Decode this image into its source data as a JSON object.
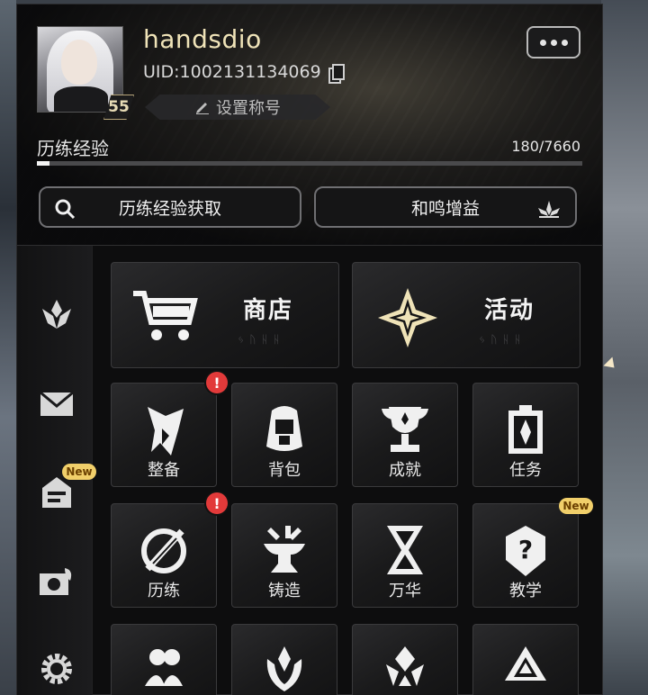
{
  "profile": {
    "username": "handsdio",
    "uid_text": "UID:1002131134069",
    "level": "55",
    "title_button": "设置称号"
  },
  "experience": {
    "label": "历练经验",
    "value_text": "180/7660",
    "current": 180,
    "max": 7660
  },
  "actions": {
    "xp_source_button": "历练经验获取",
    "resonance_button": "和鸣增益"
  },
  "sidebar": {
    "items": [
      {
        "icon": "emblem-icon"
      },
      {
        "icon": "mail-icon"
      },
      {
        "icon": "announcement-icon",
        "badge": "New"
      },
      {
        "icon": "camera-icon"
      },
      {
        "icon": "settings-gear-icon"
      }
    ]
  },
  "featured": [
    {
      "label": "商店",
      "icon": "shopping-cart-icon",
      "runes": "ᛃᚢᚺᚺ"
    },
    {
      "label": "活动",
      "icon": "star-burst-icon",
      "runes": "ᛃᚢᚺᚺ"
    }
  ],
  "grid": [
    {
      "label": "整备",
      "icon": "character-icon",
      "alert": "!"
    },
    {
      "label": "背包",
      "icon": "backpack-icon"
    },
    {
      "label": "成就",
      "icon": "trophy-icon"
    },
    {
      "label": "任务",
      "icon": "quest-scroll-icon"
    },
    {
      "label": "历练",
      "icon": "training-icon",
      "alert": "!"
    },
    {
      "label": "铸造",
      "icon": "anvil-icon"
    },
    {
      "label": "万华",
      "icon": "hourglass-icon"
    },
    {
      "label": "教学",
      "icon": "tutorial-icon",
      "badge": "New"
    },
    {
      "label": "",
      "icon": "friends-icon"
    },
    {
      "label": "",
      "icon": "crest-icon"
    },
    {
      "label": "",
      "icon": "guild-icon"
    },
    {
      "label": "",
      "icon": "compass-icon"
    }
  ],
  "colors": {
    "accent_gold": "#efe3b8",
    "alert_red": "#e23a3a",
    "new_badge": "#f1cf6a"
  }
}
